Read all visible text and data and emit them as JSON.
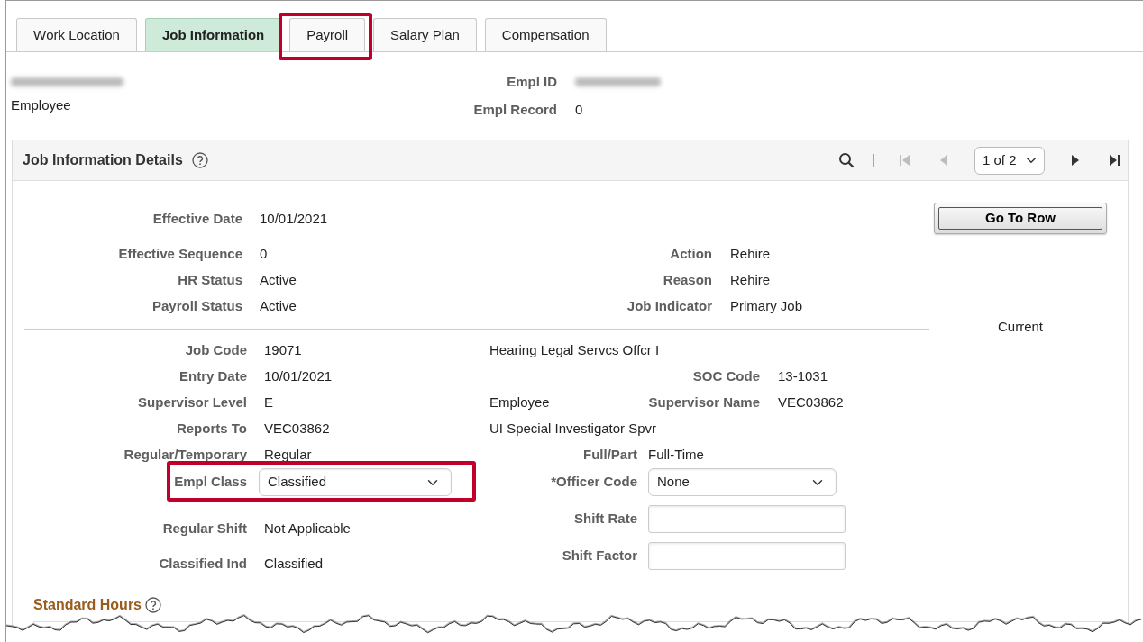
{
  "tabs": [
    {
      "label": "Work Location",
      "selected": false,
      "access_key_underlined": true,
      "highlighted": false
    },
    {
      "label": "Job Information",
      "selected": true,
      "access_key_underlined": false,
      "highlighted": false
    },
    {
      "label": "Payroll",
      "selected": false,
      "access_key_underlined": true,
      "highlighted": true
    },
    {
      "label": "Salary Plan",
      "selected": false,
      "access_key_underlined": true,
      "highlighted": false
    },
    {
      "label": "Compensation",
      "selected": false,
      "access_key_underlined": true,
      "highlighted": false
    }
  ],
  "header": {
    "name_redacted": true,
    "role": "Employee",
    "fields": [
      {
        "label": "Empl ID",
        "redacted": true
      },
      {
        "label": "Empl Record",
        "value": "0"
      }
    ]
  },
  "panel": {
    "title": "Job Information Details",
    "pager": {
      "buttons": [
        {
          "kind": "search",
          "disabled": false
        },
        {
          "kind": "first",
          "disabled": true
        },
        {
          "kind": "previous",
          "disabled": true
        },
        {
          "kind": "page"
        },
        {
          "kind": "next",
          "disabled": false
        },
        {
          "kind": "last",
          "disabled": false
        }
      ],
      "page": "1 of 2"
    },
    "go_to_row": "Go To Row",
    "row_status": "Current",
    "section_1": [
      {
        "label": "Effective Date",
        "value": "10/01/2021"
      },
      {
        "label": "Effective Sequence",
        "value": "0",
        "right_label": "Action",
        "right_value": "Rehire"
      },
      {
        "label": "HR Status",
        "value": "Active",
        "right_label": "Reason",
        "right_value": "Rehire"
      },
      {
        "label": "Payroll Status",
        "value": "Active",
        "right_label": "Job Indicator",
        "right_value": "Primary Job"
      }
    ],
    "section_2": [
      {
        "label": "Job Code",
        "value": "19071",
        "note": "Hearing Legal Servcs Offcr I"
      },
      {
        "label": "Entry Date",
        "value": "10/01/2021",
        "right_label": "SOC Code",
        "right_value": "13-1031"
      },
      {
        "label": "Supervisor Level",
        "value": "E",
        "note": "Employee",
        "right_label": "Supervisor Name",
        "right_value": "VEC03862"
      },
      {
        "label": "Reports To",
        "value": "VEC03862",
        "note": "UI Special Investigator Spvr"
      }
    ],
    "left_fields": [
      {
        "kind": "text",
        "label": "Regular/Temporary",
        "value": "Regular"
      },
      {
        "kind": "select",
        "label": "Empl Class",
        "value": "Classified",
        "highlighted": true
      },
      {
        "kind": "text",
        "label": "Regular Shift",
        "value": "Not Applicable"
      },
      {
        "kind": "text",
        "label": "Classified Ind",
        "value": "Classified"
      }
    ],
    "right_fields": [
      {
        "kind": "text",
        "label": "Full/Part",
        "value": "Full-Time"
      },
      {
        "kind": "select",
        "label": "*Officer Code",
        "value": "None"
      },
      {
        "kind": "input",
        "label": "Shift Rate"
      },
      {
        "kind": "input",
        "label": "Shift Factor"
      }
    ]
  },
  "subsection": {
    "title": "Standard Hours"
  }
}
